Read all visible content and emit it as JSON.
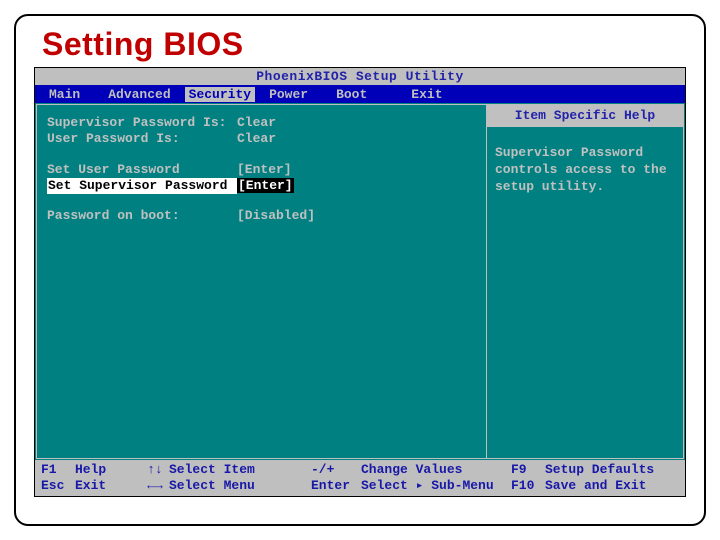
{
  "slide": {
    "title": "Setting BIOS"
  },
  "bios": {
    "title": "PhoenixBIOS Setup Utility",
    "menu": {
      "items": [
        "Main",
        "Advanced",
        "Security",
        "Power",
        "Boot",
        "Exit"
      ],
      "active": "Security"
    },
    "left": {
      "rows": [
        {
          "label": "Supervisor Password Is:",
          "value": "Clear"
        },
        {
          "label": "User Password Is:",
          "value": "Clear"
        }
      ],
      "actions": [
        {
          "label": "Set User Password",
          "value": "[Enter]",
          "selected": false
        },
        {
          "label": "Set Supervisor Password",
          "value": "[Enter]",
          "selected": true
        }
      ],
      "boot": {
        "label": "Password on boot:",
        "value": "[Disabled]"
      }
    },
    "right": {
      "title": "Item Specific Help",
      "body": "Supervisor Password controls access to the setup utility."
    },
    "footer": {
      "col1": [
        {
          "key": "F1",
          "label": "Help"
        },
        {
          "key": "Esc",
          "label": "Exit"
        }
      ],
      "col2": [
        {
          "key": "↑↓",
          "label": "Select Item"
        },
        {
          "key": "←→",
          "label": "Select Menu"
        }
      ],
      "col3": [
        {
          "key": "-/+",
          "label": "Change Values"
        },
        {
          "key": "Enter",
          "label": "Select ▸ Sub-Menu"
        }
      ],
      "col4": [
        {
          "key": "F9",
          "label": "Setup Defaults"
        },
        {
          "key": "F10",
          "label": "Save and Exit"
        }
      ]
    }
  }
}
